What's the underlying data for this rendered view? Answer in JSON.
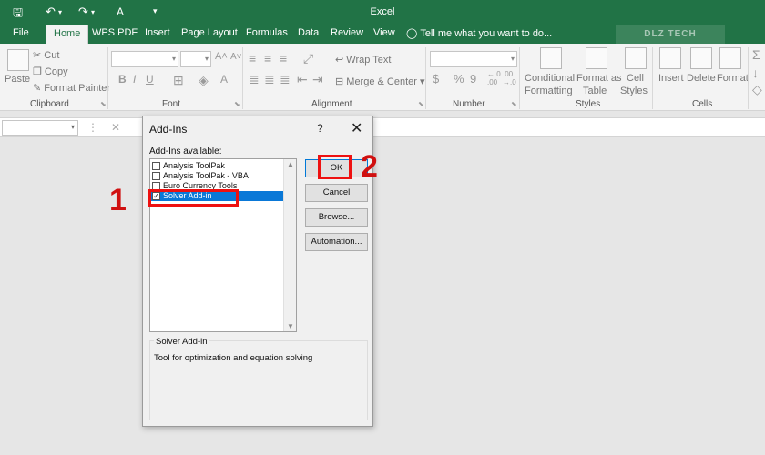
{
  "titlebar": {
    "title": "Excel",
    "quick_access": {
      "save": "🖫",
      "undo": "↶",
      "redo": "↷",
      "font_color": "A",
      "customize": "▾"
    }
  },
  "tabs": [
    "File",
    "Home",
    "WPS PDF",
    "Insert",
    "Page Layout",
    "Formulas",
    "Data",
    "Review",
    "View"
  ],
  "active_tab": "Home",
  "tell_me": "Tell me what you want to do...",
  "watermark": "DLZ TECH",
  "ribbon": {
    "clipboard": {
      "paste": "Paste",
      "cut": "Cut",
      "copy": "Copy",
      "format_painter": "Format Painter",
      "group": "Clipboard"
    },
    "font": {
      "bold": "B",
      "italic": "I",
      "underline": "U",
      "group": "Font"
    },
    "alignment": {
      "wrap_text": "Wrap Text",
      "merge_center": "Merge & Center",
      "group": "Alignment"
    },
    "number": {
      "currency": "$",
      "percent": "%",
      "comma": "9",
      "group": "Number"
    },
    "styles": {
      "conditional_formatting": [
        "Conditional",
        "Formatting"
      ],
      "format_as_table": [
        "Format as",
        "Table"
      ],
      "cell_styles": [
        "Cell",
        "Styles"
      ],
      "group": "Styles"
    },
    "cells": {
      "insert": "Insert",
      "delete": "Delete",
      "format": "Format",
      "group": "Cells"
    }
  },
  "formula_bar": {
    "cancel": "✕",
    "more": "⋮"
  },
  "dialog": {
    "title": "Add-Ins",
    "help": "?",
    "close": "✕",
    "available_label": "Add-Ins available:",
    "addins": [
      {
        "label": "Analysis ToolPak",
        "checked": false,
        "selected": false
      },
      {
        "label": "Analysis ToolPak - VBA",
        "checked": false,
        "selected": false
      },
      {
        "label": "Euro Currency Tools",
        "checked": false,
        "selected": false
      },
      {
        "label": "Solver Add-in",
        "checked": true,
        "selected": true
      }
    ],
    "buttons": {
      "ok": "OK",
      "cancel": "Cancel",
      "browse": "Browse...",
      "automation": "Automation..."
    },
    "description_title": "Solver Add-in",
    "description": "Tool for optimization and equation solving"
  },
  "annotations": {
    "step1": "1",
    "step2": "2",
    "color": "#e11111"
  },
  "colors": {
    "excel_green": "#217346",
    "selection_blue": "#0a78d7"
  }
}
